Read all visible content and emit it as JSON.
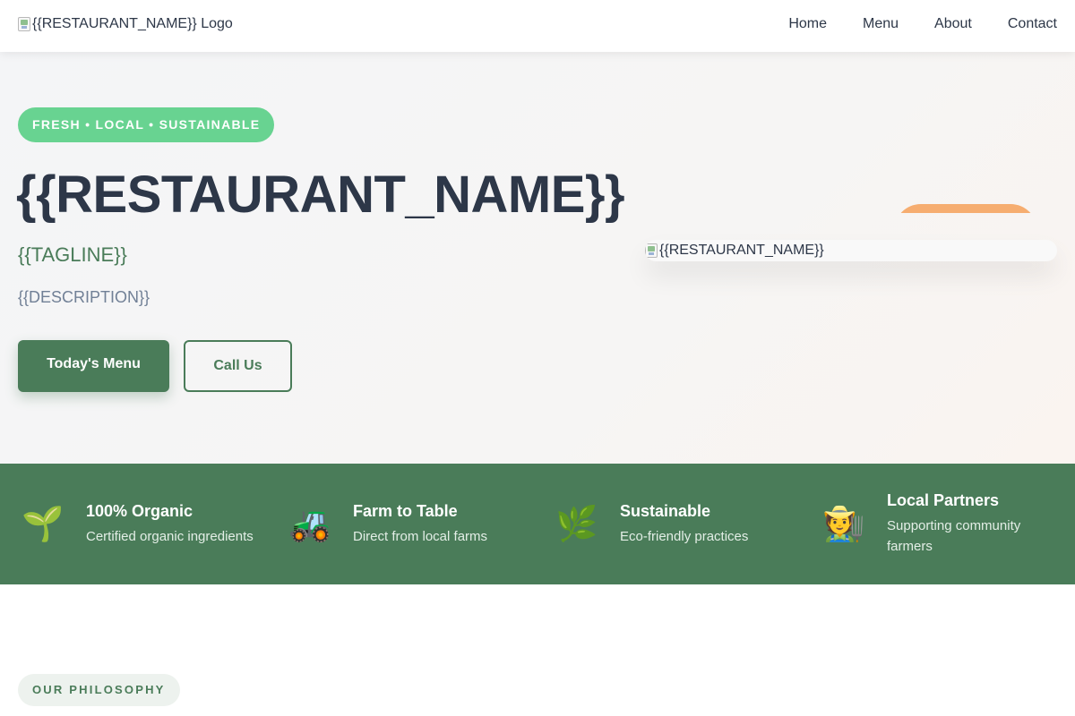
{
  "header": {
    "logo_alt": "{{RESTAURANT_NAME}} Logo",
    "nav": [
      {
        "label": "Home"
      },
      {
        "label": "Menu"
      },
      {
        "label": "About"
      },
      {
        "label": "Contact"
      }
    ]
  },
  "hero": {
    "badge": "FRESH • LOCAL • SUSTAINABLE",
    "title": "{{RESTAURANT_NAME}}",
    "tagline": "{{TAGLINE}}",
    "description": "{{DESCRIPTION}}",
    "primary_button": "Today's Menu",
    "secondary_button": "Call Us",
    "image_alt": "{{RESTAURANT_NAME}}"
  },
  "features": [
    {
      "icon": "🌱",
      "icon_name": "seedling-icon",
      "title": "100% Organic",
      "desc": "Certified organic ingredients"
    },
    {
      "icon": "🚜",
      "icon_name": "tractor-icon",
      "title": "Farm to Table",
      "desc": "Direct from local farms"
    },
    {
      "icon": "🌿",
      "icon_name": "herb-icon",
      "title": "Sustainable",
      "desc": "Eco-friendly practices"
    },
    {
      "icon": "🧑‍🌾",
      "icon_name": "farmer-icon",
      "title": "Local Partners",
      "desc": "Supporting community farmers"
    }
  ],
  "philosophy": {
    "badge": "OUR PHILOSOPHY"
  },
  "colors": {
    "primary": "#4a7c59",
    "accent": "#68d391",
    "text": "#2d3748",
    "muted": "#718096"
  }
}
